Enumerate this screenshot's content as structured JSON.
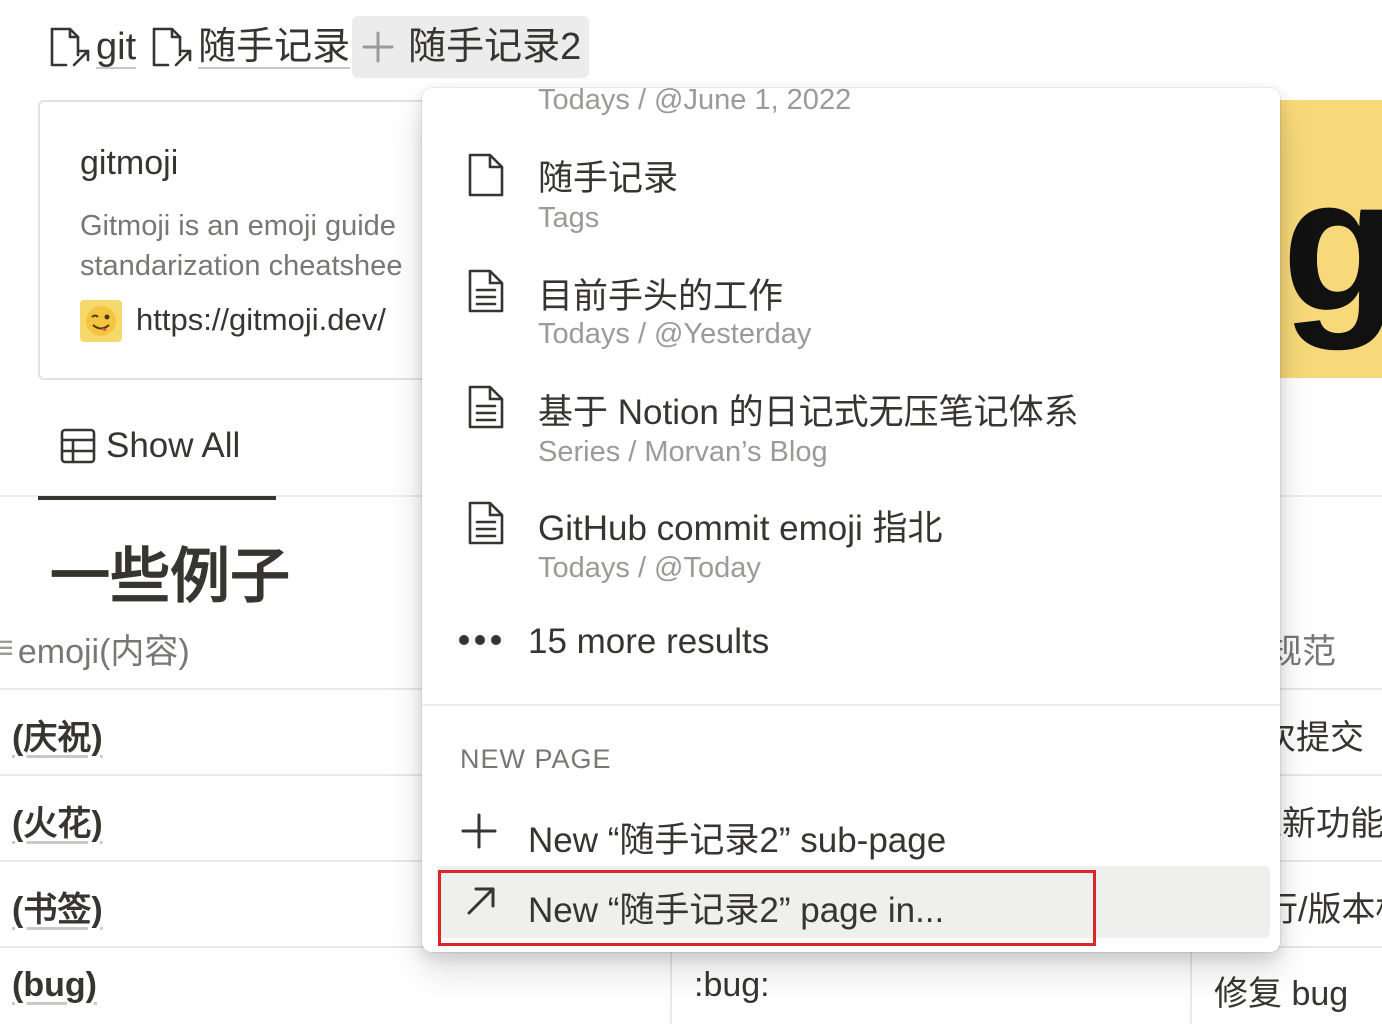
{
  "breadcrumb": {
    "links": [
      "git",
      "随手记录"
    ],
    "plus_glyph": "+",
    "query": "随手记录2"
  },
  "bookmark": {
    "title": "gitmoji",
    "description_line1": "Gitmoji is an emoji guide",
    "description_line2": "standarization cheatshee",
    "url": "https://gitmoji.dev/",
    "cover_letter": "g",
    "favicon_emoji": "😜"
  },
  "view": {
    "tab_label": "Show All"
  },
  "section": {
    "heading": "一些例子"
  },
  "table": {
    "column_emoji_header": "emoji(内容)",
    "column_desc_header": "规范",
    "rows": [
      {
        "name": "(庆祝)",
        "code": "",
        "desc": "次提交"
      },
      {
        "name": "(火花)",
        "code": "",
        "desc": "入新功能"
      },
      {
        "name": "(书签)",
        "code": "",
        "desc": "行/版本标"
      },
      {
        "name": "(bug)",
        "code": ":bug:",
        "desc": "修复 bug"
      }
    ]
  },
  "menu": {
    "results": [
      {
        "title": "",
        "sub": "Todays / @June 1, 2022",
        "icon": "page-icon"
      },
      {
        "title": "随手记录",
        "sub": "Tags",
        "icon": "page-icon"
      },
      {
        "title": "目前手头的工作",
        "sub": "Todays / @Yesterday",
        "icon": "page-text-icon"
      },
      {
        "title": "基于 Notion 的日记式无压笔记体系",
        "sub": "Series / Morvan’s Blog",
        "icon": "page-text-icon"
      },
      {
        "title": "GitHub commit emoji 指北",
        "sub": "Todays / @Today",
        "icon": "page-text-icon"
      }
    ],
    "more_results": "15 more results",
    "new_page_header": "NEW PAGE",
    "new_subpage": "New “随手记录2” sub-page",
    "new_page_in": "New “随手记录2” page in..."
  },
  "colors": {
    "text": "#37352f",
    "muted": "#9b9a97",
    "cover": "#f8d97a",
    "highlight_border": "#d9262a",
    "selected_bg": "#efefee"
  }
}
